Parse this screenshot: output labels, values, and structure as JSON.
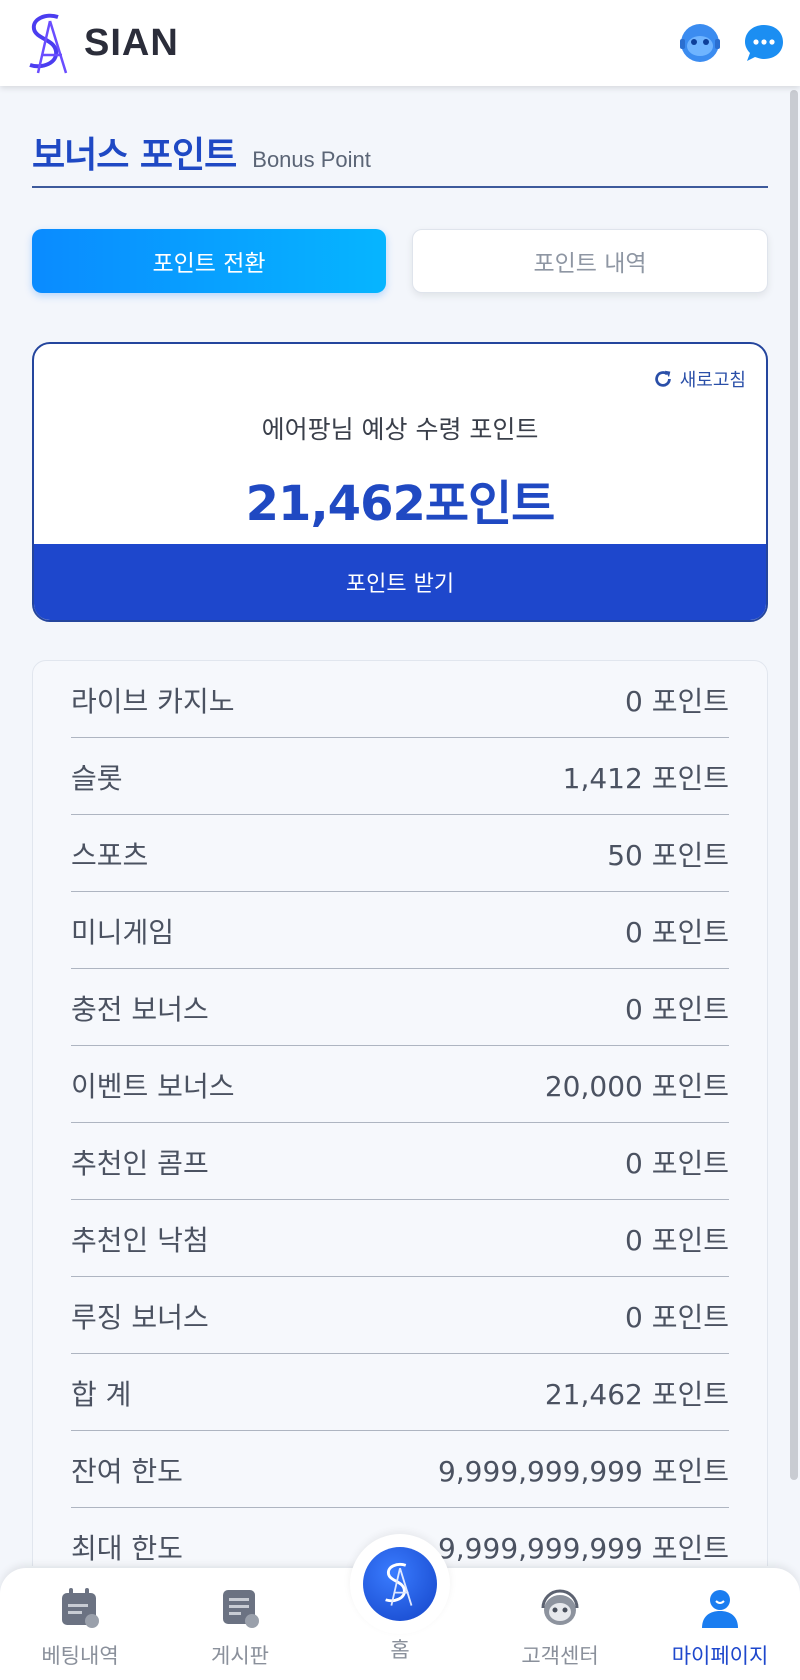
{
  "header": {
    "brand": "SIAN",
    "icons": [
      "avatar-icon",
      "chat-icon"
    ]
  },
  "page": {
    "title_ko": "보너스 포인트",
    "title_en": "Bonus Point"
  },
  "tabs": [
    {
      "label": "포인트 전환",
      "active": true
    },
    {
      "label": "포인트 내역",
      "active": false
    }
  ],
  "summary": {
    "refresh_label": "새로고침",
    "expected_label": "에어팡님 예상 수령 포인트",
    "expected_value": "21,462포인트",
    "receive_button": "포인트 받기"
  },
  "points": [
    {
      "label": "라이브 카지노",
      "value": "0 포인트"
    },
    {
      "label": "슬롯",
      "value": "1,412 포인트"
    },
    {
      "label": "스포츠",
      "value": "50 포인트"
    },
    {
      "label": "미니게임",
      "value": "0 포인트"
    },
    {
      "label": "충전 보너스",
      "value": "0 포인트"
    },
    {
      "label": "이벤트 보너스",
      "value": "20,000 포인트"
    },
    {
      "label": "추천인 콤프",
      "value": "0 포인트"
    },
    {
      "label": "추천인 낙첨",
      "value": "0 포인트"
    },
    {
      "label": "루징 보너스",
      "value": "0 포인트"
    },
    {
      "label": "합 계",
      "value": "21,462 포인트"
    },
    {
      "label": "잔여 한도",
      "value": "9,999,999,999 포인트"
    },
    {
      "label": "최대 한도",
      "value": "9,999,999,999 포인트"
    }
  ],
  "bottom_nav": [
    {
      "label": "베팅내역",
      "icon": "calendar-icon",
      "active": false
    },
    {
      "label": "게시판",
      "icon": "board-icon",
      "active": false
    },
    {
      "label": "홈",
      "icon": "home-logo-icon",
      "active": false
    },
    {
      "label": "고객센터",
      "icon": "support-icon",
      "active": false
    },
    {
      "label": "마이페이지",
      "icon": "user-icon",
      "active": true
    }
  ],
  "colors": {
    "primary": "#1e47cc",
    "accent": "#0a8bff",
    "background": "#f3f6fb"
  }
}
